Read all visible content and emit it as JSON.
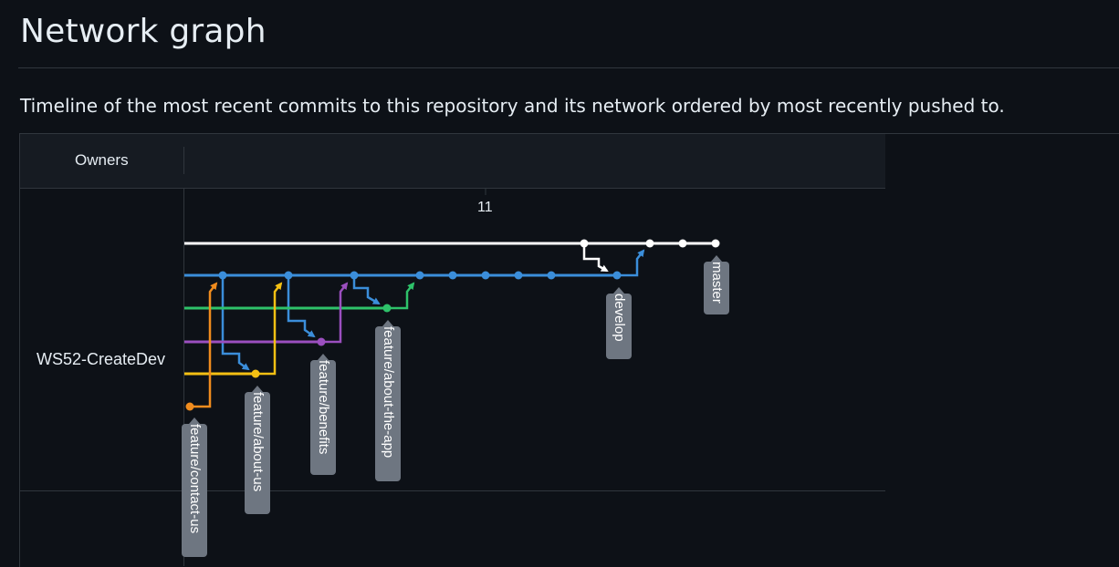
{
  "page": {
    "title": "Network graph",
    "subtitle": "Timeline of the most recent commits to this repository and its network ordered by most recently pushed to."
  },
  "graph": {
    "owners_header": "Owners",
    "owner": "WS52-CreateDev",
    "day_label": "11",
    "colors": {
      "master": "#ffffff",
      "develop": "#3b8eda",
      "feature_about_the_app": "#2ec26a",
      "feature_benefits": "#9b4fbf",
      "feature_about_us": "#f4c013",
      "feature_contact_us": "#f08c1e"
    },
    "branch_labels": {
      "master": "master",
      "develop": "develop",
      "feature_about_the_app": "feature/about-the-app",
      "feature_benefits": "feature/benefits",
      "feature_about_us": "feature/about-us",
      "feature_contact_us": "feature/contact-us"
    }
  }
}
